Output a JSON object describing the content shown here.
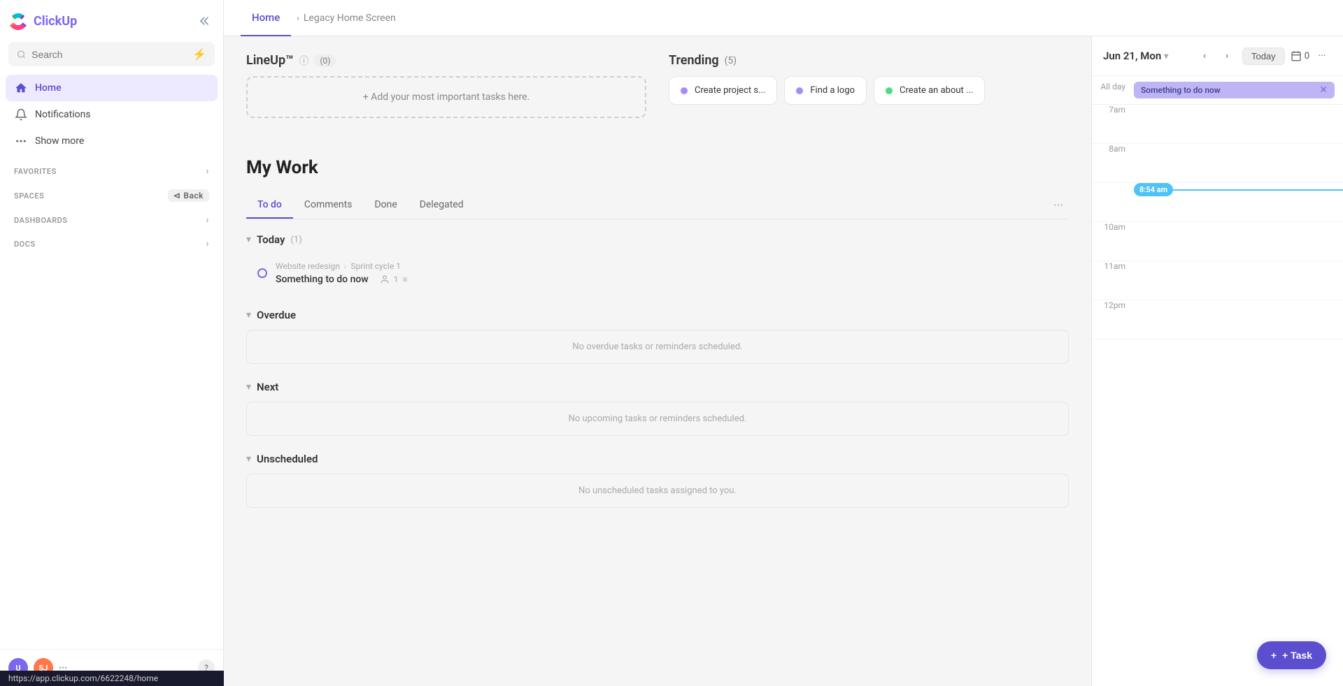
{
  "app": {
    "name": "ClickUp",
    "logo_text": "ClickUp"
  },
  "sidebar": {
    "search_placeholder": "Search",
    "nav_items": [
      {
        "id": "home",
        "label": "Home",
        "active": true,
        "icon": "home-icon"
      },
      {
        "id": "notifications",
        "label": "Notifications",
        "active": false,
        "icon": "bell-icon"
      },
      {
        "id": "show-more",
        "label": "Show more",
        "active": false,
        "icon": "dots-icon"
      }
    ],
    "sections": [
      {
        "id": "favorites",
        "label": "FAVORITES",
        "has_arrow": true
      },
      {
        "id": "spaces",
        "label": "SPACES",
        "has_back": true,
        "back_label": "Back"
      },
      {
        "id": "dashboards",
        "label": "DASHBOARDS",
        "has_arrow": true
      },
      {
        "id": "docs",
        "label": "DOCS",
        "has_arrow": true
      }
    ],
    "avatars": [
      {
        "id": "u",
        "initials": "U",
        "color": "#7b68ee"
      },
      {
        "id": "sj",
        "initials": "SJ",
        "color": "#ff7849"
      }
    ],
    "help_label": "?",
    "status_url": "https://app.clickup.com/6622248/home"
  },
  "header": {
    "active_tab": "Home",
    "legacy_tab": "Legacy Home Screen"
  },
  "lineup": {
    "title": "LineUp™",
    "count": "(0)",
    "add_label": "+ Add your most important tasks here."
  },
  "trending": {
    "title": "Trending",
    "count": "(5)",
    "items": [
      {
        "id": "create-project",
        "label": "Create project s...",
        "dot_color": "#a78bfa"
      },
      {
        "id": "find-logo",
        "label": "Find a logo",
        "dot_color": "#a78bfa"
      },
      {
        "id": "create-about",
        "label": "Create an about ...",
        "dot_color": "#4ade80"
      }
    ]
  },
  "my_work": {
    "title": "My Work",
    "tabs": [
      {
        "id": "todo",
        "label": "To do",
        "active": true
      },
      {
        "id": "comments",
        "label": "Comments",
        "active": false
      },
      {
        "id": "done",
        "label": "Done",
        "active": false
      },
      {
        "id": "delegated",
        "label": "Delegated",
        "active": false
      }
    ],
    "sections": {
      "today": {
        "title": "Today",
        "count": "(1)",
        "tasks": [
          {
            "id": "task-1",
            "breadcrumb_part1": "Website redesign",
            "breadcrumb_part2": "Sprint cycle 1",
            "name": "Something to do now",
            "assignee_count": "1",
            "dot_color": "#7b68ee"
          }
        ]
      },
      "overdue": {
        "title": "Overdue",
        "empty_message": "No overdue tasks or reminders scheduled."
      },
      "next": {
        "title": "Next",
        "empty_message": "No upcoming tasks or reminders scheduled."
      },
      "unscheduled": {
        "title": "Unscheduled",
        "empty_message": "No unscheduled tasks assigned to you."
      }
    }
  },
  "calendar": {
    "date_label": "Jun 21, Mon",
    "today_label": "Today",
    "count": "0",
    "all_day_label": "All day",
    "event": {
      "title": "Something to do now"
    },
    "time_slots": [
      {
        "id": "7am",
        "label": "7am"
      },
      {
        "id": "8am",
        "label": "8am"
      },
      {
        "id": "current",
        "label": "8:54 am",
        "is_current": true
      },
      {
        "id": "10am",
        "label": "10am"
      },
      {
        "id": "11am",
        "label": "11am"
      },
      {
        "id": "12pm",
        "label": "12pm"
      }
    ]
  },
  "add_task": {
    "label": "+ Task"
  }
}
